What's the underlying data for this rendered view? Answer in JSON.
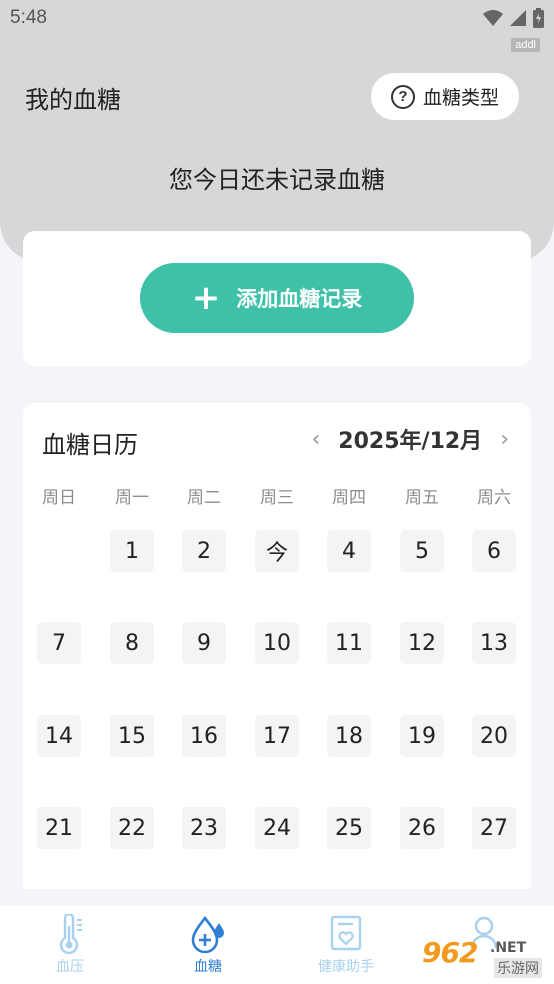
{
  "status_bar": {
    "time": "5:48",
    "tag": "addl"
  },
  "header": {
    "title": "我的血糖",
    "type_button_label": "血糖类型",
    "notice": "您今日还未记录血糖"
  },
  "add_record": {
    "label": "添加血糖记录"
  },
  "calendar": {
    "title": "血糖日历",
    "month": "2025年/12月",
    "weekdays": [
      "周日",
      "周一",
      "周二",
      "周三",
      "周四",
      "周五",
      "周六"
    ],
    "rows": [
      [
        "",
        "1",
        "2",
        "今",
        "4",
        "5",
        "6"
      ],
      [
        "7",
        "8",
        "9",
        "10",
        "11",
        "12",
        "13"
      ],
      [
        "14",
        "15",
        "16",
        "17",
        "18",
        "19",
        "20"
      ],
      [
        "21",
        "22",
        "23",
        "24",
        "25",
        "26",
        "27"
      ]
    ]
  },
  "bottom_nav": {
    "items": [
      {
        "label": "血压",
        "icon": "thermometer-icon",
        "active": false
      },
      {
        "label": "血糖",
        "icon": "blood-drop-icon",
        "active": true
      },
      {
        "label": "健康助手",
        "icon": "health-assistant-icon",
        "active": false
      },
      {
        "label": "",
        "icon": "profile-icon",
        "active": false
      }
    ]
  },
  "watermark": {
    "number": "962",
    "domain": ".NET",
    "text": "乐游网"
  },
  "colors": {
    "header_bg": "#d7d7d7",
    "accent": "#3ec1a8",
    "nav_active": "#2f7fd4",
    "nav_inactive": "#a7d1ee"
  }
}
